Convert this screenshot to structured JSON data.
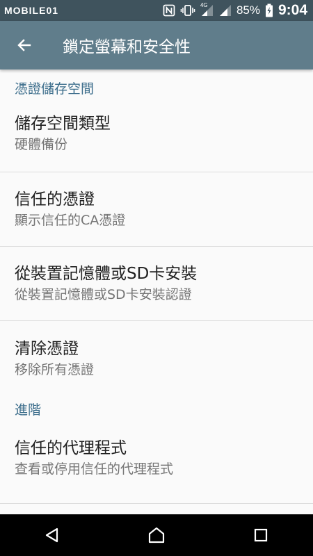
{
  "status_bar": {
    "watermark": "MOBILE01",
    "battery_percent": "85%",
    "time": "9:04",
    "network_label": "4G",
    "icons": [
      "nfc-icon",
      "vibrate-icon",
      "signal-icon",
      "battery-charging-icon"
    ]
  },
  "app_bar": {
    "back_icon": "arrow-left-icon",
    "title": "鎖定螢幕和安全性"
  },
  "sections": [
    {
      "header": "憑證儲存空間",
      "items": [
        {
          "title": "儲存空間類型",
          "summary": "硬體備份"
        },
        {
          "title": "信任的憑證",
          "summary": "顯示信任的CA憑證"
        },
        {
          "title": "從裝置記憶體或SD卡安裝",
          "summary": "從裝置記憶體或SD卡安裝認證"
        },
        {
          "title": "清除憑證",
          "summary": "移除所有憑證"
        }
      ]
    },
    {
      "header": "進階",
      "items": [
        {
          "title": "信任的代理程式",
          "summary": "查看或停用信任的代理程式"
        }
      ]
    }
  ],
  "nav_bar": {
    "icons": [
      "back-triangle-icon",
      "home-icon",
      "recents-square-icon"
    ]
  },
  "colors": {
    "status_bar": "#3f535d",
    "app_bar": "#607d8b",
    "section_header": "#3d6e8c",
    "title_text": "#212121",
    "summary_text": "#757575"
  }
}
